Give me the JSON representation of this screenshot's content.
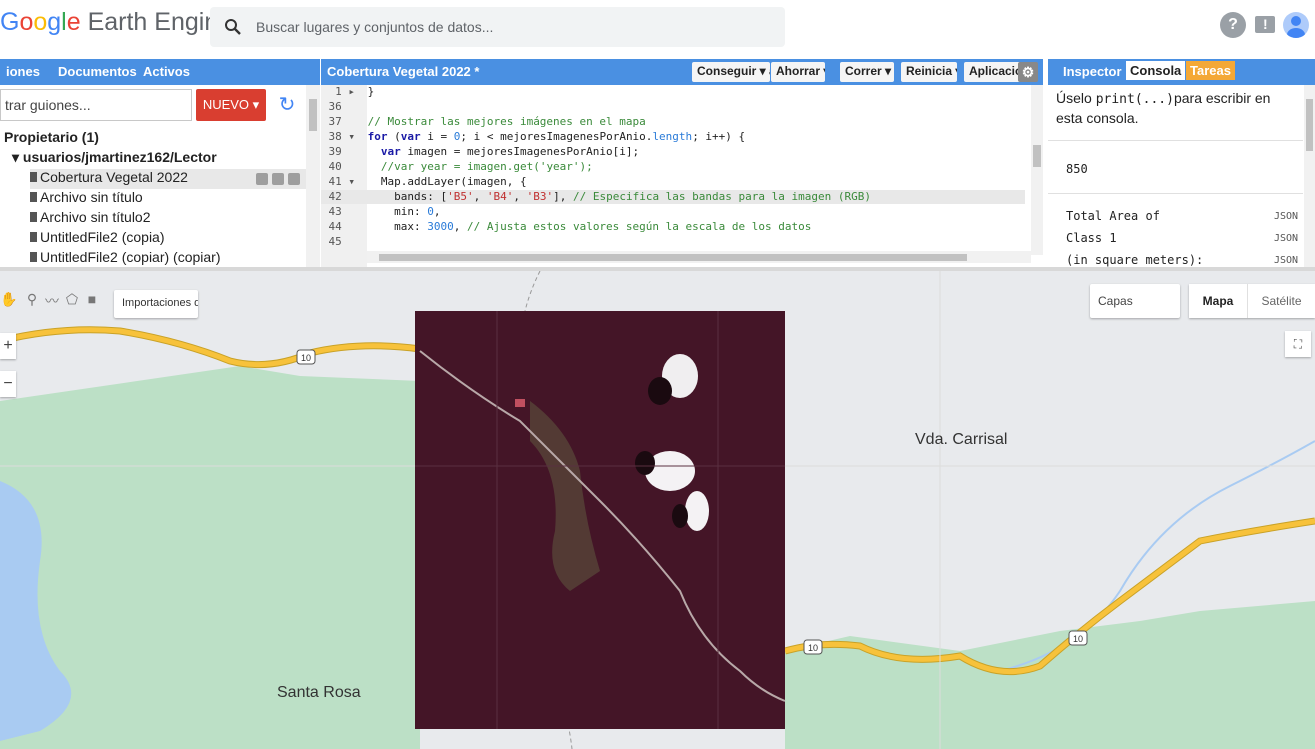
{
  "app": {
    "logo_text": "Google Earth Engine",
    "search_placeholder": "Buscar lugares y conjuntos de datos..."
  },
  "left_panel": {
    "tabs": [
      "iones",
      "Documentos",
      "Activos"
    ],
    "filter_placeholder": "trar guiones...",
    "new_button": "NUEVO ▾",
    "owner_label": "Propietario (1)",
    "user_folder": "usuarios/jmartinez162/Lector",
    "files": [
      "Cobertura Vegetal 2022",
      "Archivo sin título",
      "Archivo sin título2",
      "UntitledFile2 (copia)",
      "UntitledFile2 (copiar) (copiar)"
    ]
  },
  "editor": {
    "title": "Cobertura Vegetal 2022 *",
    "buttons": {
      "get_link": "Conseguir ▾ ac",
      "save": "Ahorrar ▾",
      "run": "Correr ▾",
      "reset": "Reinicia ▾",
      "apps": "Aplicaciones"
    },
    "lines": [
      {
        "num": "1",
        "fold": "▸",
        "text": "}"
      },
      {
        "num": "36",
        "fold": "",
        "text": ""
      },
      {
        "num": "37",
        "fold": "",
        "text": "// Mostrar las mejores imágenes en el mapa"
      },
      {
        "num": "38",
        "fold": "▾",
        "text": "for (var i = 0; i < mejoresImagenesPorAnio.length; i++) {"
      },
      {
        "num": "39",
        "fold": "",
        "text": "  var imagen = mejoresImagenesPorAnio[i];"
      },
      {
        "num": "40",
        "fold": "",
        "text": "  //var year = imagen.get('year');"
      },
      {
        "num": "41",
        "fold": "▾",
        "text": "  Map.addLayer(imagen, {"
      },
      {
        "num": "42",
        "fold": "",
        "text": "    bands: ['B5', 'B4', 'B3'], // Especifica las bandas para la imagen (RGB)"
      },
      {
        "num": "43",
        "fold": "",
        "text": "    min: 0,"
      },
      {
        "num": "44",
        "fold": "",
        "text": "    max: 3000, // Ajusta estos valores según la escala de los datos"
      },
      {
        "num": "45",
        "fold": "",
        "text": ""
      }
    ],
    "highlighted_line": "42"
  },
  "right_panel": {
    "tabs": {
      "inspector": "Inspector",
      "console": "Consola",
      "tasks": "Tareas"
    },
    "hint_prefix": "Úselo ",
    "hint_code": "print(...)",
    "hint_suffix": "para escribir en esta consola.",
    "outputs": [
      {
        "text": "850",
        "tag": ""
      },
      {
        "text": "Total Area of",
        "tag": "JSON"
      },
      {
        "text": "Class 1",
        "tag": "JSON"
      },
      {
        "text": " (in square meters):",
        "tag": "JSON"
      }
    ]
  },
  "map": {
    "imports_button": "Importaciones de ge",
    "layers_button": "Capas",
    "map_type_map": "Mapa",
    "map_type_satellite": "Satélite",
    "place_labels": [
      "Vda. Carrisal",
      "Santa Rosa"
    ],
    "road_shield": "10",
    "colors": {
      "land": "#e8eaed",
      "forest": "#bce0c6",
      "water": "#a9cbf2",
      "road": "#f7c23b",
      "image": "#4a1a2c"
    }
  }
}
